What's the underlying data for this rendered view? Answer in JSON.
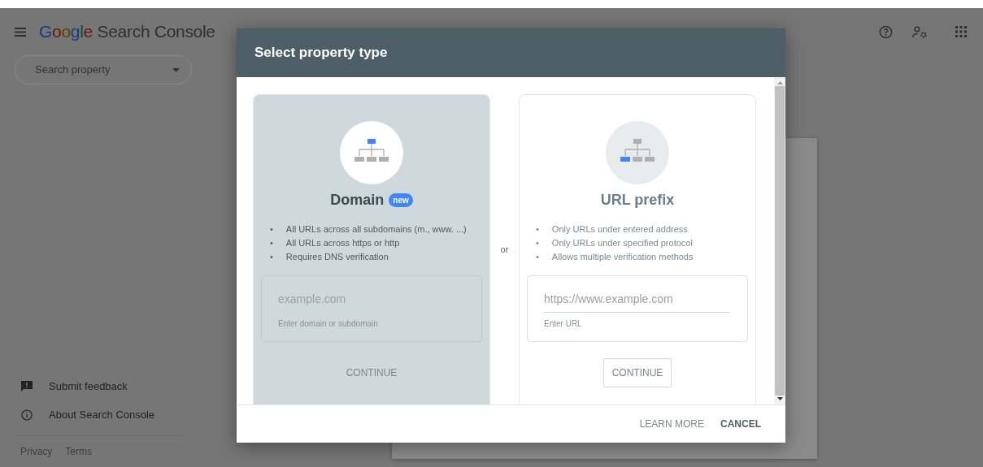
{
  "header": {
    "logo": "Google",
    "product": "Search Console"
  },
  "search_property": {
    "placeholder": "Search property"
  },
  "sidebar": {
    "items": [
      {
        "kind": "feedback",
        "label": "Submit feedback"
      },
      {
        "kind": "about",
        "label": "About Search Console"
      }
    ],
    "footer_links": [
      "Privacy",
      "Terms"
    ]
  },
  "dialog": {
    "title": "Select property type",
    "options": [
      {
        "kind": "domain",
        "title": "Domain",
        "badge": "new",
        "selected": true,
        "bullets": [
          "All URLs across all subdomains (m., www. ...)",
          "All URLs across https or http",
          "Requires DNS verification"
        ],
        "input": {
          "placeholder": "example.com",
          "hint": "Enter domain or subdomain"
        },
        "button": "CONTINUE"
      },
      {
        "kind": "url_prefix",
        "title": "URL prefix",
        "selected": false,
        "bullets": [
          "Only URLs under entered address",
          "Only URLs under specified protocol",
          "Allows multiple verification methods"
        ],
        "input": {
          "placeholder": "https://www.example.com",
          "hint": "Enter URL"
        },
        "button": "CONTINUE"
      }
    ],
    "separator": "or",
    "bullet_marker": "•",
    "actions": [
      {
        "kind": "secondary",
        "label": "LEARN MORE"
      },
      {
        "kind": "primary",
        "label": "CANCEL"
      }
    ]
  }
}
